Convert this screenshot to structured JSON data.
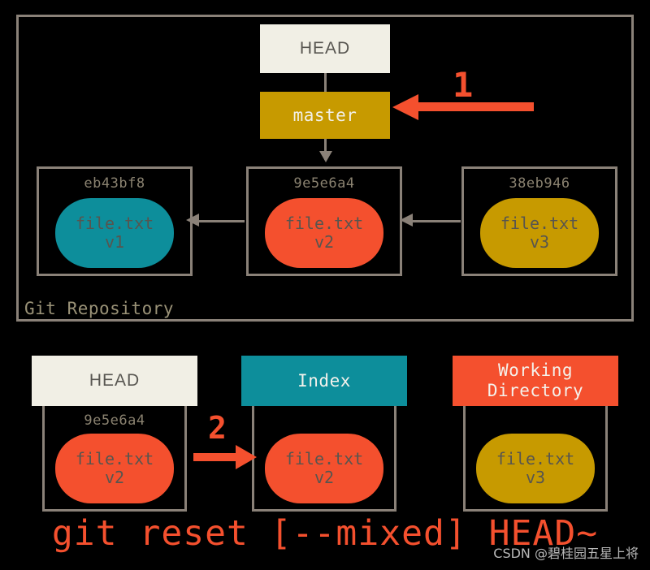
{
  "diagram": {
    "repository": {
      "label": "Git Repository",
      "border_color": "#8a8178",
      "pointers": {
        "head": {
          "label": "HEAD",
          "bg": "#f1efe5",
          "text_color": "#585651"
        },
        "branch": {
          "label": "master",
          "bg": "#c79a00",
          "text_color": "#f2f0e8"
        }
      },
      "commits": [
        {
          "hash": "eb43bf8",
          "file": "file.txt",
          "version": "v1",
          "blob_color": "#0d8e9b"
        },
        {
          "hash": "9e5e6a4",
          "file": "file.txt",
          "version": "v2",
          "blob_color": "#f4502e"
        },
        {
          "hash": "38eb946",
          "file": "file.txt",
          "version": "v3",
          "blob_color": "#c79a00"
        }
      ]
    },
    "areas": [
      {
        "title": "HEAD",
        "header_bg": "#f1efe5",
        "header_text_color": "#585651",
        "hash": "9e5e6a4",
        "file": "file.txt",
        "version": "v2",
        "blob_color": "#f4502e"
      },
      {
        "title": "Index",
        "header_bg": "#0d8e9b",
        "header_text_color": "#f4f2ec",
        "hash": "",
        "file": "file.txt",
        "version": "v2",
        "blob_color": "#f4502e"
      },
      {
        "title": "Working\nDirectory",
        "header_bg": "#f4502e",
        "header_text_color": "#f4f2ec",
        "hash": "",
        "file": "file.txt",
        "version": "v3",
        "blob_color": "#c79a00"
      }
    ],
    "annotations": [
      {
        "label": "1",
        "color": "#f4502e",
        "direction": "left",
        "target": "master"
      },
      {
        "label": "2",
        "color": "#f4502e",
        "direction": "right",
        "target": "index"
      }
    ],
    "command": "git reset [--mixed] HEAD~",
    "command_color": "#f4502e",
    "watermark": "CSDN @碧桂园五星上将"
  }
}
